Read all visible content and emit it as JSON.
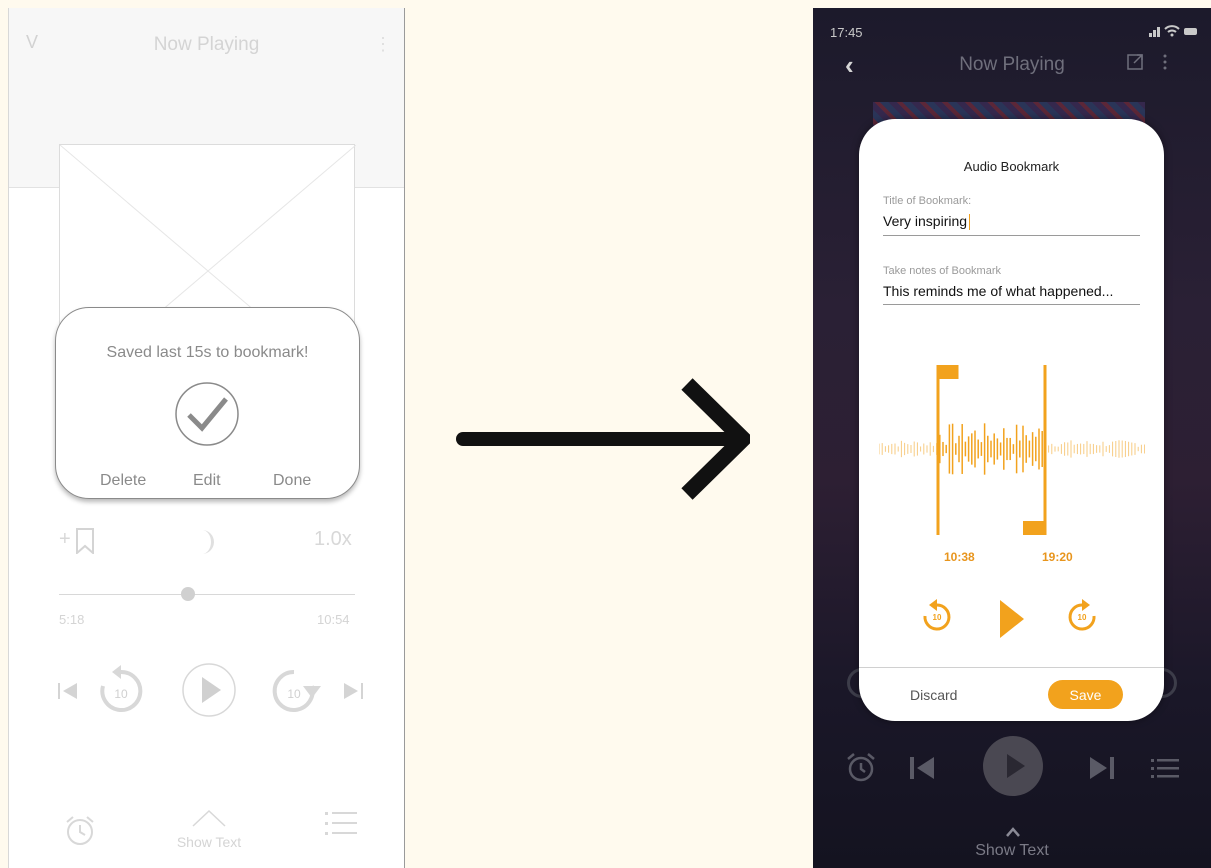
{
  "wireframe": {
    "title": "Now Playing",
    "chevron": "V",
    "dialog": {
      "message": "Saved last 15s to bookmark!",
      "delete_label": "Delete",
      "edit_label": "Edit",
      "done_label": "Done"
    },
    "speed": "1.0x",
    "bookmark_prefix": "+",
    "time_current": "5:18",
    "time_total": "10:54",
    "skip_label": "10",
    "show_text": "Show Text"
  },
  "mockup": {
    "status_time": "17:45",
    "title": "Now Playing",
    "bookmark_card": {
      "title": "Audio Bookmark",
      "title_field_label": "Title of Bookmark:",
      "title_field_value": "Very inspiring",
      "notes_field_label": "Take notes of Bookmark",
      "notes_field_value": "This reminds me of what happened...",
      "start_time": "10:38",
      "end_time": "19:20",
      "skip_label": "10",
      "discard_label": "Discard",
      "save_label": "Save"
    },
    "show_text": "Show Text"
  },
  "colors": {
    "accent": "#f2a21d",
    "wireframe_gray": "#8a8a8a",
    "page_bg": "#fffaee"
  }
}
